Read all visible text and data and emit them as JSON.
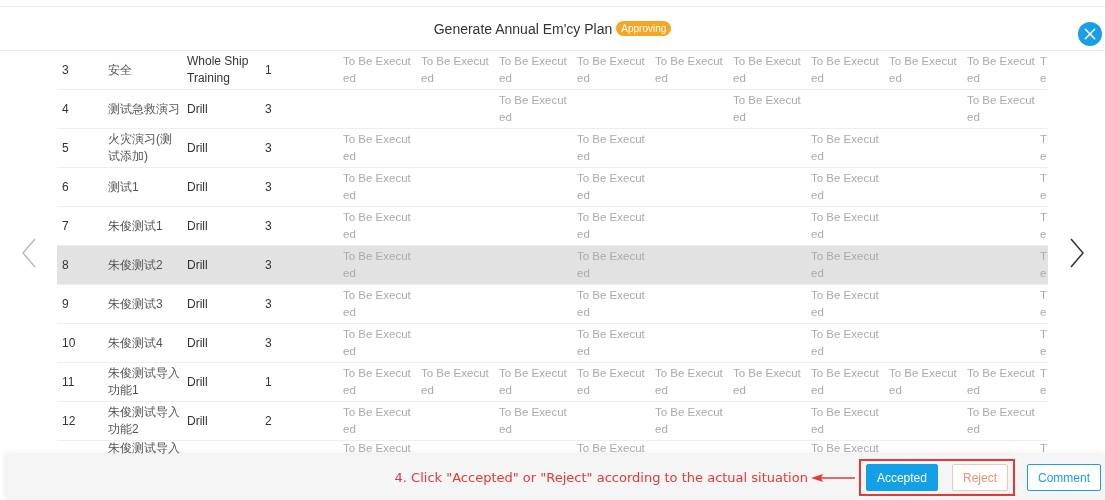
{
  "dialog": {
    "title": "Generate Annual Em'cy Plan",
    "status_badge": "Approving"
  },
  "table": {
    "rows": [
      {
        "index": "3",
        "name": "安全",
        "type": "Whole Ship Training",
        "count": "1",
        "highlighted": false,
        "plan": [
          {
            "kind": "status",
            "text": "To Be Executed"
          },
          {
            "kind": "status",
            "text": "To Be Executed"
          },
          {
            "kind": "status",
            "text": "To Be Executed"
          },
          {
            "kind": "status",
            "text": "To Be Executed"
          },
          {
            "kind": "status",
            "text": "To Be Executed"
          },
          {
            "kind": "status",
            "text": "To Be Executed"
          },
          {
            "kind": "status",
            "text": "To Be Executed"
          },
          {
            "kind": "status",
            "text": "To Be Executed"
          },
          {
            "kind": "status",
            "text": "To Be Executed"
          },
          {
            "kind": "status",
            "text": "Te"
          }
        ]
      },
      {
        "index": "4",
        "name": "测试急救演习",
        "type": "Drill",
        "count": "3",
        "highlighted": false,
        "plan": [
          {
            "kind": "blank"
          },
          {
            "kind": "blank"
          },
          {
            "kind": "status",
            "text": "To Be Executed"
          },
          {
            "kind": "blank"
          },
          {
            "kind": "blank"
          },
          {
            "kind": "status",
            "text": "To Be Executed"
          },
          {
            "kind": "blank"
          },
          {
            "kind": "blank"
          },
          {
            "kind": "status",
            "text": "To Be Executed"
          },
          {
            "kind": "blank"
          }
        ]
      },
      {
        "index": "5",
        "name": "火灾演习(测试添加)",
        "type": "Drill",
        "count": "3",
        "highlighted": false,
        "plan": [
          {
            "kind": "status",
            "text": "To Be Executed"
          },
          {
            "kind": "blank"
          },
          {
            "kind": "blank"
          },
          {
            "kind": "status",
            "text": "To Be Executed"
          },
          {
            "kind": "blank"
          },
          {
            "kind": "blank"
          },
          {
            "kind": "status",
            "text": "To Be Executed"
          },
          {
            "kind": "blank"
          },
          {
            "kind": "blank"
          },
          {
            "kind": "status",
            "text": "Te"
          }
        ]
      },
      {
        "index": "6",
        "name": "测试1",
        "type": "Drill",
        "count": "3",
        "highlighted": false,
        "plan": [
          {
            "kind": "status",
            "text": "To Be Executed"
          },
          {
            "kind": "blank"
          },
          {
            "kind": "blank"
          },
          {
            "kind": "status",
            "text": "To Be Executed"
          },
          {
            "kind": "blank"
          },
          {
            "kind": "blank"
          },
          {
            "kind": "status",
            "text": "To Be Executed"
          },
          {
            "kind": "blank"
          },
          {
            "kind": "blank"
          },
          {
            "kind": "status",
            "text": "Te"
          }
        ]
      },
      {
        "index": "7",
        "name": "朱俊测试1",
        "type": "Drill",
        "count": "3",
        "highlighted": false,
        "plan": [
          {
            "kind": "status",
            "text": "To Be Executed"
          },
          {
            "kind": "blank"
          },
          {
            "kind": "blank"
          },
          {
            "kind": "status",
            "text": "To Be Executed"
          },
          {
            "kind": "blank"
          },
          {
            "kind": "blank"
          },
          {
            "kind": "status",
            "text": "To Be Executed"
          },
          {
            "kind": "blank"
          },
          {
            "kind": "blank"
          },
          {
            "kind": "status",
            "text": "Te"
          }
        ]
      },
      {
        "index": "8",
        "name": "朱俊测试2",
        "type": "Drill",
        "count": "3",
        "highlighted": true,
        "plan": [
          {
            "kind": "status",
            "text": "To Be Executed"
          },
          {
            "kind": "blank"
          },
          {
            "kind": "blank"
          },
          {
            "kind": "status",
            "text": "To Be Executed"
          },
          {
            "kind": "blank"
          },
          {
            "kind": "blank"
          },
          {
            "kind": "status",
            "text": "To Be Executed"
          },
          {
            "kind": "blank"
          },
          {
            "kind": "blank"
          },
          {
            "kind": "status",
            "text": "Te"
          }
        ]
      },
      {
        "index": "9",
        "name": "朱俊测试3",
        "type": "Drill",
        "count": "3",
        "highlighted": false,
        "plan": [
          {
            "kind": "status",
            "text": "To Be Executed"
          },
          {
            "kind": "blank"
          },
          {
            "kind": "blank"
          },
          {
            "kind": "status",
            "text": "To Be Executed"
          },
          {
            "kind": "blank"
          },
          {
            "kind": "blank"
          },
          {
            "kind": "status",
            "text": "To Be Executed"
          },
          {
            "kind": "blank"
          },
          {
            "kind": "blank"
          },
          {
            "kind": "status",
            "text": "Te"
          }
        ]
      },
      {
        "index": "10",
        "name": "朱俊测试4",
        "type": "Drill",
        "count": "3",
        "highlighted": false,
        "plan": [
          {
            "kind": "status",
            "text": "To Be Executed"
          },
          {
            "kind": "blank"
          },
          {
            "kind": "blank"
          },
          {
            "kind": "status",
            "text": "To Be Executed"
          },
          {
            "kind": "blank"
          },
          {
            "kind": "blank"
          },
          {
            "kind": "status",
            "text": "To Be Executed"
          },
          {
            "kind": "blank"
          },
          {
            "kind": "blank"
          },
          {
            "kind": "status",
            "text": "Te"
          }
        ]
      },
      {
        "index": "11",
        "name": "朱俊测试导入功能1",
        "type": "Drill",
        "count": "1",
        "highlighted": false,
        "plan": [
          {
            "kind": "status",
            "text": "To Be Executed"
          },
          {
            "kind": "status",
            "text": "To Be Executed"
          },
          {
            "kind": "status",
            "text": "To Be Executed"
          },
          {
            "kind": "status",
            "text": "To Be Executed"
          },
          {
            "kind": "status",
            "text": "To Be Executed"
          },
          {
            "kind": "status",
            "text": "To Be Executed"
          },
          {
            "kind": "status",
            "text": "To Be Executed"
          },
          {
            "kind": "status",
            "text": "To Be Executed"
          },
          {
            "kind": "status",
            "text": "To Be Executed"
          },
          {
            "kind": "status",
            "text": "Te"
          }
        ]
      },
      {
        "index": "12",
        "name": "朱俊测试导入功能2",
        "type": "Drill",
        "count": "2",
        "highlighted": false,
        "plan": [
          {
            "kind": "status",
            "text": "To Be Executed"
          },
          {
            "kind": "blank"
          },
          {
            "kind": "status",
            "text": "To Be Executed"
          },
          {
            "kind": "blank"
          },
          {
            "kind": "status",
            "text": "To Be Executed"
          },
          {
            "kind": "blank"
          },
          {
            "kind": "status",
            "text": "To Be Executed"
          },
          {
            "kind": "blank"
          },
          {
            "kind": "status",
            "text": "To Be Executed"
          },
          {
            "kind": "blank"
          }
        ]
      },
      {
        "name": "朱俊测试导入",
        "highlighted": false,
        "plan": [
          {
            "kind": "status",
            "text": "To Be Execut"
          },
          {
            "kind": "blank"
          },
          {
            "kind": "blank"
          },
          {
            "kind": "status",
            "text": "To Be Execut"
          },
          {
            "kind": "blank"
          },
          {
            "kind": "blank"
          },
          {
            "kind": "status",
            "text": "To Be Execut"
          },
          {
            "kind": "blank"
          },
          {
            "kind": "blank"
          },
          {
            "kind": "status",
            "text": "T"
          }
        ]
      }
    ]
  },
  "annotation": {
    "text": "4. Click \"Accepted\" or \"Reject\" according to the actual situation"
  },
  "buttons": [
    {
      "label": "Accepted",
      "kind": "primary",
      "framed": true
    },
    {
      "label": "Reject",
      "kind": "danger",
      "framed": true
    },
    {
      "label": "Comment",
      "kind": "outline",
      "framed": false
    }
  ]
}
